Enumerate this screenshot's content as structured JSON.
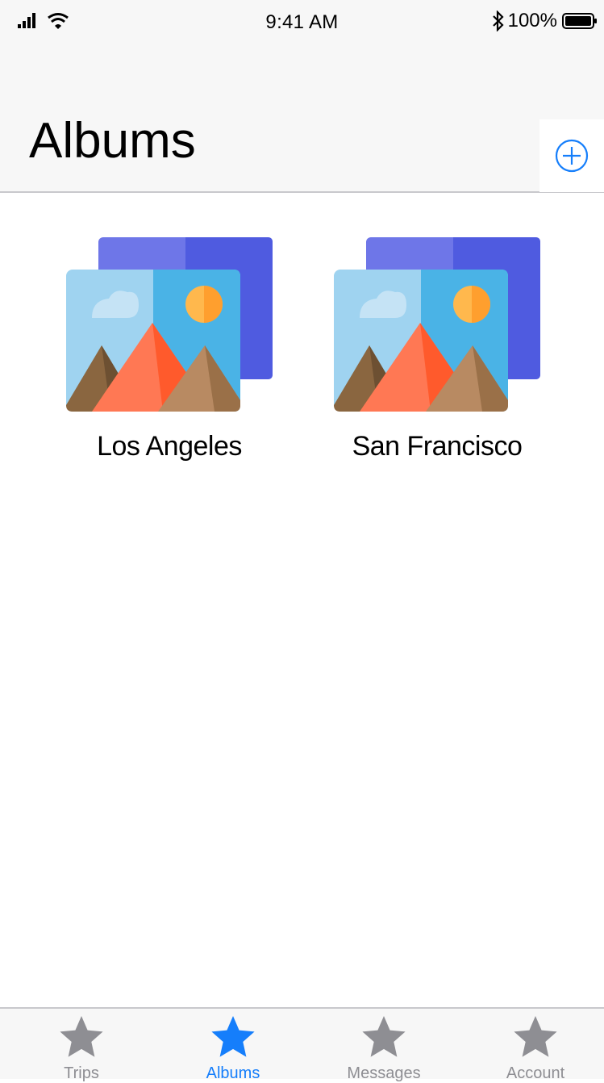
{
  "status_bar": {
    "time": "9:41 AM",
    "battery": "100%",
    "icons": [
      "signal-icon",
      "wifi-icon",
      "bluetooth-icon",
      "battery-icon"
    ]
  },
  "header": {
    "title": "Albums",
    "add_icon": "plus-circle-icon"
  },
  "albums": [
    {
      "name": "Los Angeles",
      "icon": "photo-stack-icon"
    },
    {
      "name": "San Francisco",
      "icon": "photo-stack-icon"
    }
  ],
  "tab_bar": {
    "active": "Albums",
    "items": [
      {
        "label": "Trips",
        "icon": "star-icon"
      },
      {
        "label": "Albums",
        "icon": "star-icon"
      },
      {
        "label": "Messages",
        "icon": "star-icon"
      },
      {
        "label": "Account",
        "icon": "star-icon"
      }
    ]
  },
  "colors": {
    "accent": "#157efb",
    "inactive": "#8e8e93",
    "bar_background": "#f7f7f7",
    "divider": "#c8c8cc"
  }
}
